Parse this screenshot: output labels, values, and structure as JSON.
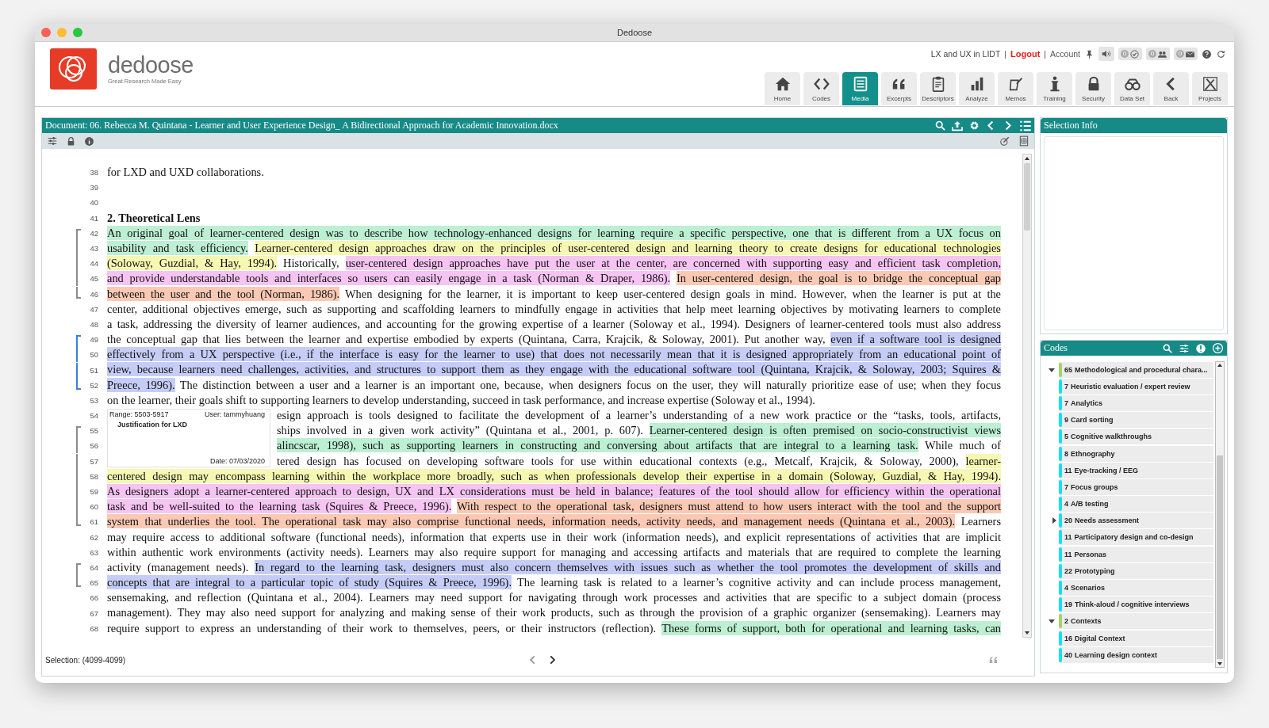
{
  "window": {
    "title": "Dedoose"
  },
  "logo": {
    "name": "dedoose",
    "tagline": "Great Research Made Easy"
  },
  "account_bar": {
    "project": "LX and UX in LIDT",
    "separators": [
      "|",
      "|"
    ],
    "logout": "Logout",
    "account": "Account",
    "badges": [
      "0",
      "0",
      "0"
    ]
  },
  "toolbar": [
    {
      "label": "Home",
      "selected": false
    },
    {
      "label": "Codes",
      "selected": false
    },
    {
      "label": "Media",
      "selected": true
    },
    {
      "label": "Excerpts",
      "selected": false
    },
    {
      "label": "Descriptors",
      "selected": false
    },
    {
      "label": "Analyze",
      "selected": false
    },
    {
      "label": "Memos",
      "selected": false
    },
    {
      "label": "Training",
      "selected": false
    },
    {
      "label": "Security",
      "selected": false
    },
    {
      "label": "Data Set",
      "selected": false
    },
    {
      "label": "Back",
      "selected": false
    },
    {
      "label": "Projects",
      "selected": false
    }
  ],
  "document": {
    "title": "Document: 06. Rebecca M. Quintana - Learner and User Experience Design_ A Bidirectional Approach for Academic Innovation.docx",
    "lines": [
      {
        "number": "38",
        "kind": "last",
        "segments": [
          {
            "text": "for LXD and UXD collaborations."
          }
        ]
      },
      {
        "number": "39",
        "kind": "blank"
      },
      {
        "number": "40",
        "kind": "blank"
      },
      {
        "number": "41",
        "kind": "heading",
        "segments": [
          {
            "text": "2. Theoretical Lens"
          }
        ]
      },
      {
        "number": "42",
        "kind": "line",
        "bracket": {
          "color": "#8c8c8c"
        },
        "segments": [
          {
            "text": "An original goal of learner-centered design was to describe how technology-enhanced designs for learning require a specific perspective, one that is different from a UX focus on",
            "color": "#bdefd3"
          }
        ]
      },
      {
        "number": "43",
        "kind": "line",
        "bracket": {
          "color": "#8c8c8c"
        },
        "segments": [
          {
            "text": "usability and task efficiency.",
            "color": "#bdefd3"
          },
          {
            "text": "Learner-centered design approaches draw on the principles of user-centered design and learning theory to create designs for educational technologies",
            "color": "#f6f7b2"
          }
        ]
      },
      {
        "number": "44",
        "kind": "line",
        "bracket": {
          "color": "#8c8c8c"
        },
        "segments": [
          {
            "text": "(Soloway, Guzdial, & Hay, 1994).",
            "color": "#f6f7b2"
          },
          {
            "text": "Historically,"
          },
          {
            "text": "user-centered design approaches have put the user at the center, are concerned with supporting easy and efficient task completion,",
            "color": "#f5c4f2"
          }
        ]
      },
      {
        "number": "45",
        "kind": "line",
        "bracket": {
          "color": "#8c8c8c"
        },
        "segments": [
          {
            "text": "and provide understandable tools and interfaces so users can easily engage in a task (Norman & Draper, 1986).",
            "color": "#f5c4f2"
          },
          {
            "text": "In user-centered design, the goal is to bridge the conceptual gap",
            "color": "#fac9b4"
          }
        ]
      },
      {
        "number": "46",
        "kind": "line",
        "bracket": {
          "color": "#8c8c8c"
        },
        "segments": [
          {
            "text": "between the user and the tool (Norman, 1986).",
            "color": "#fac9b4"
          },
          {
            "text": "When designing for the learner, it is important to keep user-centered design goals in mind. However, when the learner is put at the"
          }
        ]
      },
      {
        "number": "47",
        "kind": "line",
        "segments": [
          {
            "text": "center, additional objectives emerge, such as supporting and scaffolding learners to mindfully engage in activities that help meet learning objectives by motivating learners to complete"
          }
        ]
      },
      {
        "number": "48",
        "kind": "line",
        "segments": [
          {
            "text": "a task, addressing the diversity of learner audiences, and accounting for the growing expertise of a learner (Soloway et al., 1994). Designers of learner-centered tools must also address"
          }
        ]
      },
      {
        "number": "49",
        "kind": "line",
        "bracket": {
          "color": "#3c7fd8"
        },
        "segments": [
          {
            "text": "the conceptual gap that lies between the learner and expertise embodied by experts (Quintana, Carra, Krajcik, & Soloway, 2001). Put another way,"
          },
          {
            "text": "even if a software tool is designed",
            "color": "#c5cdf6"
          }
        ]
      },
      {
        "number": "50",
        "kind": "line",
        "bracket": {
          "color": "#3c7fd8"
        },
        "segments": [
          {
            "text": "effectively from a UX perspective (i.e., if the interface is easy for the learner to use) that does not necessarily mean that it is designed appropriately from an educational point of",
            "color": "#c5cdf6"
          }
        ]
      },
      {
        "number": "51",
        "kind": "line",
        "bracket": {
          "color": "#3c7fd8"
        },
        "segments": [
          {
            "text": "view, because learners need challenges, activities, and structures to support them as they engage with the educational software tool (Quintana, Krajcik, & Soloway, 2003; Squires &",
            "color": "#c5cdf6"
          }
        ]
      },
      {
        "number": "52",
        "kind": "line",
        "bracket": {
          "color": "#3c7fd8"
        },
        "segments": [
          {
            "text": "Preece, 1996).",
            "color": "#c5cdf6"
          },
          {
            "text": "The distinction between a user and a learner is an important one, because, when designers focus on the user, they will naturally prioritize ease of use; when they focus"
          }
        ]
      },
      {
        "number": "53",
        "kind": "last",
        "segments": [
          {
            "text": "on the learner, their goals shift to supporting learners to develop understanding, succeed in task performance, and increase expertise (Soloway et al., 1994)."
          }
        ]
      },
      {
        "number": "54",
        "kind": "line",
        "covered": true,
        "segments": [
          {
            "text": "esign approach is tools designed to facilitate the development of a learner’s understanding of a new work practice or the “tasks, tools, artifacts,"
          }
        ],
        "tooltip": {
          "range": "Range: 5503-5917",
          "user": "User: tammyhuang",
          "code": "Justification for LXD",
          "date": "Date: 07/03/2020"
        }
      },
      {
        "number": "55",
        "kind": "line",
        "covered": true,
        "bracket": {
          "color": "#8c8c8c"
        },
        "segments": [
          {
            "text": "ships involved in a given work activity” (Quintana et al., 2001, p. 607)."
          },
          {
            "text": "Learner-centered design is often premised on socio-constructivist views",
            "color": "#bdefd3"
          }
        ]
      },
      {
        "number": "56",
        "kind": "line",
        "covered": true,
        "bracket": {
          "color": "#8c8c8c"
        },
        "segments": [
          {
            "text": "alincscar, 1998), such as supporting learners in constructing and conversing about artifacts that are integral to a learning task.",
            "color": "#bdefd3"
          },
          {
            "text": "While much of"
          }
        ]
      },
      {
        "number": "57",
        "kind": "line",
        "covered": true,
        "bracket": {
          "color": "#8c8c8c"
        },
        "segments": [
          {
            "text": "tered design has focused on developing software tools for use within educational contexts (e.g., Metcalf, Krajcik, & Soloway, 2000),"
          },
          {
            "text": "learner-",
            "color": "#f6f7b2"
          }
        ]
      },
      {
        "number": "58",
        "kind": "line",
        "bracket": {
          "color": "#8c8c8c"
        },
        "segments": [
          {
            "text": "centered design may encompass learning within the workplace more broadly, such as when professionals develop their expertise in a domain (Soloway, Guzdial, & Hay, 1994).",
            "color": "#f6f7b2"
          }
        ]
      },
      {
        "number": "59",
        "kind": "line",
        "bracket": {
          "color": "#8c8c8c"
        },
        "segments": [
          {
            "text": "As designers adopt a learner-centered approach to design, UX and LX considerations must be held in balance; features of the tool should allow for efficiency within the operational",
            "color": "#f5c4f2"
          }
        ]
      },
      {
        "number": "60",
        "kind": "line",
        "bracket": {
          "color": "#8c8c8c"
        },
        "segments": [
          {
            "text": "task and be well-suited to the learning task (Squires & Preece, 1996).",
            "color": "#f5c4f2"
          },
          {
            "text": "With respect to the operational task, designers must attend to how users interact with the tool and the support",
            "color": "#fac9b4"
          }
        ]
      },
      {
        "number": "61",
        "kind": "line",
        "bracket": {
          "color": "#8c8c8c"
        },
        "segments": [
          {
            "text": "system that underlies the tool. The operational task may also comprise functional needs, information needs, activity needs, and management needs (Quintana et al., 2003).",
            "color": "#fac9b4"
          },
          {
            "text": "Learners"
          }
        ]
      },
      {
        "number": "62",
        "kind": "line",
        "segments": [
          {
            "text": "may require access to additional software (functional needs), information that experts use in their work (information needs), and explicit representations of activities that are implicit"
          }
        ]
      },
      {
        "number": "63",
        "kind": "line",
        "segments": [
          {
            "text": "within authentic work environments (activity needs). Learners may also require support for managing and accessing artifacts and materials that are required to complete the learning"
          }
        ]
      },
      {
        "number": "64",
        "kind": "line",
        "bracket": {
          "color": "#8c8c8c"
        },
        "segments": [
          {
            "text": "activity (management needs)."
          },
          {
            "text": "In regard to the learning task, designers must also concern themselves with issues such as whether the tool promotes the development of skills and",
            "color": "#c5cdf6"
          }
        ]
      },
      {
        "number": "65",
        "kind": "line",
        "bracket": {
          "color": "#8c8c8c"
        },
        "segments": [
          {
            "text": "concepts that are integral to a particular topic of study (Squires & Preece, 1996).",
            "color": "#c5cdf6"
          },
          {
            "text": "The learning task is related to a learner’s cognitive activity and can include process management,"
          }
        ]
      },
      {
        "number": "66",
        "kind": "line",
        "segments": [
          {
            "text": "sensemaking, and reflection (Quintana et al., 2004). Learners may need support for navigating through work processes and activities that are specific to a subject domain (process"
          }
        ]
      },
      {
        "number": "67",
        "kind": "line",
        "segments": [
          {
            "text": "management). They may also need support for analyzing and making sense of their work products, such as through the provision of a graphic organizer (sensemaking). Learners may"
          }
        ]
      },
      {
        "number": "68",
        "kind": "line",
        "segments": [
          {
            "text": "require support to express an understanding of their work to themselves, peers, or their instructors (reflection)."
          },
          {
            "text": "These forms of support, both for operational and learning tasks, can",
            "color": "#bdefd3"
          }
        ]
      }
    ],
    "selection": "Selection: (4099-4099)"
  },
  "selection_info": {
    "title": "Selection Info"
  },
  "codes": {
    "title": "Codes",
    "items": [
      {
        "count": "65",
        "name": "Methodological and procedural chara...",
        "color": "#a3d36a",
        "expanded": true,
        "children": [
          {
            "count": "7",
            "name": "Heuristic evaluation / expert review",
            "color": "#12e0f5"
          },
          {
            "count": "7",
            "name": "Analytics",
            "color": "#12e0f5"
          },
          {
            "count": "9",
            "name": "Card sorting",
            "color": "#12e0f5"
          },
          {
            "count": "5",
            "name": "Cognitive walkthroughs",
            "color": "#12e0f5"
          },
          {
            "count": "8",
            "name": "Ethnography",
            "color": "#12e0f5"
          },
          {
            "count": "11",
            "name": "Eye-tracking / EEG",
            "color": "#12e0f5"
          },
          {
            "count": "7",
            "name": "Focus groups",
            "color": "#12e0f5"
          },
          {
            "count": "4",
            "name": "A/B testing",
            "color": "#12e0f5"
          },
          {
            "count": "20",
            "name": "Needs assessment",
            "color": "#12e0f5",
            "expanded": false
          },
          {
            "count": "11",
            "name": "Participatory design and co-design",
            "color": "#12e0f5"
          },
          {
            "count": "11",
            "name": "Personas",
            "color": "#12e0f5"
          },
          {
            "count": "22",
            "name": "Prototyping",
            "color": "#12e0f5"
          },
          {
            "count": "4",
            "name": "Scenarios",
            "color": "#12e0f5"
          },
          {
            "count": "19",
            "name": "Think-aloud / cognitive interviews",
            "color": "#12e0f5"
          }
        ]
      },
      {
        "count": "2",
        "name": "Contexts",
        "color": "#a3d36a",
        "expanded": true,
        "children": [
          {
            "count": "16",
            "name": "Digital Context",
            "color": "#12e0f5"
          },
          {
            "count": "40",
            "name": "Learning design context",
            "color": "#12e0f5"
          }
        ]
      }
    ]
  }
}
